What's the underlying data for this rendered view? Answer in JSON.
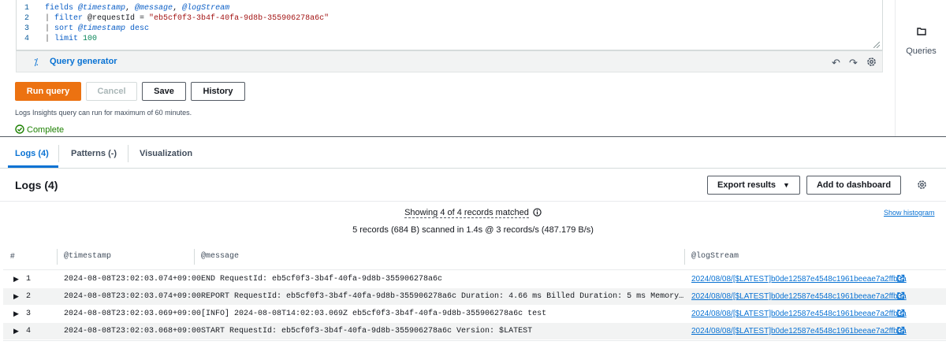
{
  "editor": {
    "lines": [
      {
        "num": "1",
        "parts": [
          {
            "t": "kw",
            "v": "fields "
          },
          {
            "t": "var",
            "v": "@timestamp"
          },
          {
            "t": "",
            "v": ", "
          },
          {
            "t": "var",
            "v": "@message"
          },
          {
            "t": "",
            "v": ", "
          },
          {
            "t": "var",
            "v": "@logStream"
          }
        ]
      },
      {
        "num": "2",
        "parts": [
          {
            "t": "pipe",
            "v": "| "
          },
          {
            "t": "kw",
            "v": "filter "
          },
          {
            "t": "",
            "v": "@requestId = "
          },
          {
            "t": "str",
            "v": "\"eb5cf0f3-3b4f-40fa-9d8b-355906278a6c\""
          }
        ]
      },
      {
        "num": "3",
        "parts": [
          {
            "t": "pipe",
            "v": "| "
          },
          {
            "t": "kw",
            "v": "sort "
          },
          {
            "t": "var",
            "v": "@timestamp"
          },
          {
            "t": "kw",
            "v": " desc"
          }
        ]
      },
      {
        "num": "4",
        "parts": [
          {
            "t": "pipe",
            "v": "| "
          },
          {
            "t": "kw",
            "v": "limit "
          },
          {
            "t": "num",
            "v": "100"
          }
        ]
      }
    ],
    "query_generator_label": "Query generator",
    "undo_icon": "undo-icon",
    "redo_icon": "redo-icon",
    "settings_icon": "gear-icon"
  },
  "right_panel": {
    "queries_label": "Queries",
    "icon": "folder-icon"
  },
  "actions": {
    "run": "Run query",
    "cancel": "Cancel",
    "save": "Save",
    "history": "History"
  },
  "hint": "Logs Insights query can run for maximum of 60 minutes.",
  "status": {
    "label": "Complete",
    "color": "#1d8102"
  },
  "tabs": [
    {
      "label": "Logs (4)",
      "active": true
    },
    {
      "label": "Patterns (-)",
      "active": false
    },
    {
      "label": "Visualization",
      "active": false
    }
  ],
  "logs": {
    "title": "Logs (4)",
    "export_label": "Export results",
    "dashboard_label": "Add to dashboard",
    "showing": "Showing 4 of 4 records matched",
    "scanned": "5 records (684 B) scanned in 1.4s @ 3 records/s (487.179 B/s)",
    "show_histogram": "Show histogram",
    "columns": [
      "#",
      "@timestamp",
      "@message",
      "@logStream"
    ],
    "rows": [
      {
        "idx": "1",
        "timestamp": "2024-08-08T23:02:03.074+09:00",
        "message": "END RequestId: eb5cf0f3-3b4f-40fa-9d8b-355906278a6c",
        "stream": "2024/08/08/[$LATEST]b0de12587e4548c1961beeae7a2ffb3a"
      },
      {
        "idx": "2",
        "timestamp": "2024-08-08T23:02:03.074+09:00",
        "message": "REPORT RequestId: eb5cf0f3-3b4f-40fa-9d8b-355906278a6c Duration: 4.66 ms Billed Duration: 5 ms Memory Size: 128 …",
        "stream": "2024/08/08/[$LATEST]b0de12587e4548c1961beeae7a2ffb3a"
      },
      {
        "idx": "3",
        "timestamp": "2024-08-08T23:02:03.069+09:00",
        "message": "[INFO] 2024-08-08T14:02:03.069Z eb5cf0f3-3b4f-40fa-9d8b-355906278a6c test",
        "stream": "2024/08/08/[$LATEST]b0de12587e4548c1961beeae7a2ffb3a"
      },
      {
        "idx": "4",
        "timestamp": "2024-08-08T23:02:03.068+09:00",
        "message": "START RequestId: eb5cf0f3-3b4f-40fa-9d8b-355906278a6c Version: $LATEST",
        "stream": "2024/08/08/[$LATEST]b0de12587e4548c1961beeae7a2ffb3a"
      }
    ]
  },
  "colors": {
    "accent": "#0972d3",
    "run_button": "#ec7211"
  }
}
